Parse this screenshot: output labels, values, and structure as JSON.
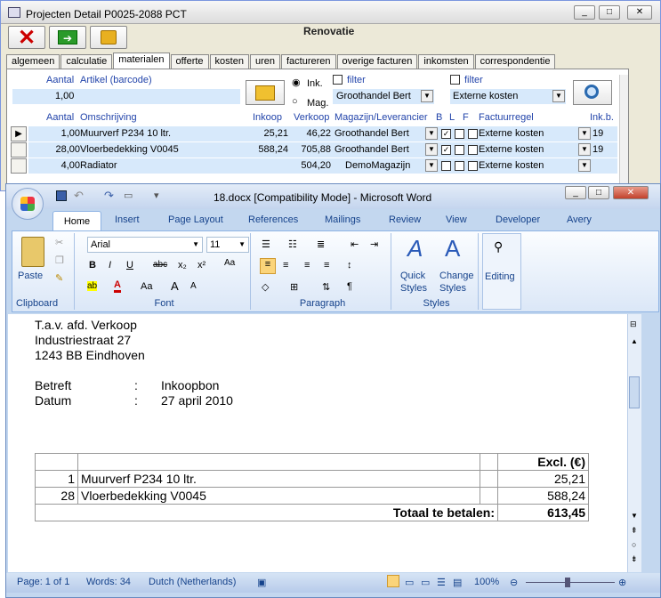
{
  "back": {
    "title": "Projecten Detail   P0025-2088   PCT",
    "project_name": "Renovatie",
    "tabs": [
      "algemeen",
      "calculatie",
      "materialen",
      "offerte",
      "kosten",
      "uren",
      "factureren",
      "overige facturen",
      "inkomsten",
      "correspondentie"
    ],
    "active_tab": "materialen",
    "top": {
      "aantal_label": "Aantal",
      "artikel_label": "Artikel (barcode)",
      "aantal_value": "1,00",
      "ink_label": "Ink.",
      "mag_label": "Mag.",
      "filter1": "filter",
      "filter2": "filter",
      "supplier": "Groothandel Bert",
      "cost_type": "Externe kosten"
    },
    "headers": {
      "aantal": "Aantal",
      "omschrijving": "Omschrijving",
      "inkoop": "Inkoop",
      "verkoop": "Verkoop",
      "magazijn": "Magazijn/Leverancier",
      "b": "B",
      "l": "L",
      "f": "F",
      "factuurregel": "Factuurregel",
      "inkb": "Ink.b."
    },
    "rows": [
      {
        "aantal": "1,00",
        "omschrijving": "Muurverf P234 10 ltr.",
        "inkoop": "25,21",
        "verkoop": "46,22",
        "magazijn": "Groothandel Bert",
        "b": true,
        "factuurregel": "Externe kosten",
        "inkb": "19"
      },
      {
        "aantal": "28,00",
        "omschrijving": "Vloerbedekking V0045",
        "inkoop": "588,24",
        "verkoop": "705,88",
        "magazijn": "Groothandel Bert",
        "b": true,
        "factuurregel": "Externe kosten",
        "inkb": "19"
      },
      {
        "aantal": "4,00",
        "omschrijving": "Radiator",
        "inkoop": "",
        "verkoop": "504,20",
        "magazijn": "DemoMagazijn",
        "b": false,
        "factuurregel": "Externe kosten",
        "inkb": ""
      }
    ]
  },
  "word": {
    "title": "18.docx [Compatibility Mode] - Microsoft Word",
    "tabs": [
      "Home",
      "Insert",
      "Page Layout",
      "References",
      "Mailings",
      "Review",
      "View",
      "Developer",
      "Avery"
    ],
    "font_name": "Arial",
    "font_size": "11",
    "groups": {
      "clipboard": "Clipboard",
      "font": "Font",
      "paragraph": "Paragraph",
      "styles": "Styles"
    },
    "paste": "Paste",
    "quick_styles_1": "Quick",
    "quick_styles_2": "Styles",
    "change_styles_1": "Change",
    "change_styles_2": "Styles",
    "editing": "Editing",
    "doc": {
      "l1": "T.a.v. afd. Verkoop",
      "l2": "Industriestraat 27",
      "l3": "1243 BB  Eindhoven",
      "betreft_label": "Betreft",
      "betreft_sep": ":",
      "betreft_value": "Inkoopbon",
      "datum_label": "Datum",
      "datum_sep": ":",
      "datum_value": "27 april 2010",
      "col_header": "Excl. (€)",
      "rows": [
        {
          "qty": "1",
          "desc": "Muurverf P234 10 ltr.",
          "amount": "25,21"
        },
        {
          "qty": "28",
          "desc": "Vloerbedekking V0045",
          "amount": "588,24"
        }
      ],
      "total_label": "Totaal te betalen:",
      "total_value": "613,45"
    },
    "status": {
      "page": "Page: 1 of 1",
      "words": "Words: 34",
      "language": "Dutch (Netherlands)",
      "zoom": "100%"
    }
  }
}
